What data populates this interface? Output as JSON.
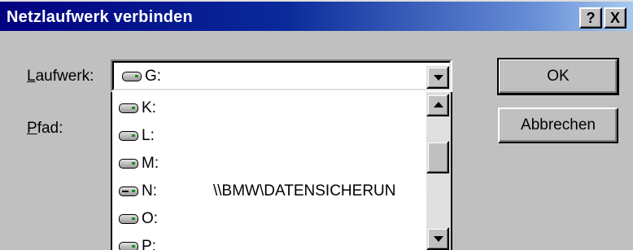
{
  "window": {
    "title": "Netzlaufwerk verbinden",
    "help_button": "?",
    "close_button": "X"
  },
  "form": {
    "drive_label_mnemonic": "L",
    "drive_label_rest": "aufwerk:",
    "path_label_mnemonic": "P",
    "path_label_rest": "fad:",
    "selected_drive": "G:"
  },
  "drive_list": [
    {
      "letter": "K:",
      "path": "",
      "icon": "drive-icon"
    },
    {
      "letter": "L:",
      "path": "",
      "icon": "drive-icon"
    },
    {
      "letter": "M:",
      "path": "",
      "icon": "drive-icon"
    },
    {
      "letter": "N:",
      "path": "\\\\BMW\\DATENSICHERUN",
      "icon": "network-drive-icon"
    },
    {
      "letter": "O:",
      "path": "",
      "icon": "drive-icon"
    },
    {
      "letter": "P:",
      "path": "",
      "icon": "drive-icon"
    }
  ],
  "buttons": {
    "ok": "OK",
    "cancel": "Abbrechen"
  }
}
